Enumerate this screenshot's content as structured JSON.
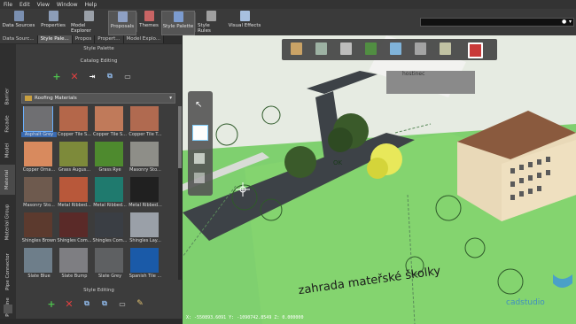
{
  "menu": [
    "File",
    "Edit",
    "View",
    "Window",
    "Help"
  ],
  "ribbon": {
    "buttons": [
      {
        "label": "Data Sources",
        "icon": "database-icon",
        "color": "#7a8fb0"
      },
      {
        "label": "Properties",
        "icon": "properties-icon",
        "color": "#8c9db8"
      },
      {
        "label": "Model Explorer",
        "icon": "model-explorer-icon",
        "color": "#9aa0a8"
      },
      {
        "label": "Proposals",
        "icon": "proposals-icon",
        "color": "#8ea0c4"
      },
      {
        "label": "Themes",
        "icon": "themes-icon",
        "color": "#c86464"
      },
      {
        "label": "Style Palette",
        "icon": "style-palette-icon",
        "color": "#7c9cd0"
      },
      {
        "label": "Style Rules",
        "icon": "style-rules-icon",
        "color": "#a0a0a0"
      },
      {
        "label": "Visual Effects",
        "icon": "visual-effects-icon",
        "color": "#a8c0e0"
      }
    ]
  },
  "panel_tabs": [
    "Data Sourc...",
    "Style Pale...",
    "Propos",
    "Propert...",
    "Model Explo..."
  ],
  "panel_title": "Style Palette",
  "catalog_title": "Catalog Editing",
  "style_editing_title": "Style Editing",
  "vertical_tabs": [
    "Barrier",
    "Facade",
    "Model",
    "Material",
    "Material Group",
    "Pipe Connector",
    "Pipeline"
  ],
  "dropdown": {
    "value": "Roofing Materials"
  },
  "materials": [
    {
      "name": "Asphalt Grey",
      "color": "#6f6f72",
      "selected": true
    },
    {
      "name": "Copper Tile S...",
      "color": "#b4674a"
    },
    {
      "name": "Copper Tile S...",
      "color": "#c07a5a"
    },
    {
      "name": "Copper Tile T...",
      "color": "#b06a50"
    },
    {
      "name": "Copper Orna...",
      "color": "#d88a5e"
    },
    {
      "name": "Grass Augus...",
      "color": "#7d8a3a"
    },
    {
      "name": "Grass Rye",
      "color": "#4e8a2e"
    },
    {
      "name": "Masonry Sto...",
      "color": "#8e8e88"
    },
    {
      "name": "Masonry Sto...",
      "color": "#6e5a4e"
    },
    {
      "name": "Metal Ribbed...",
      "color": "#b8583a"
    },
    {
      "name": "Metal Ribbed...",
      "color": "#1f7a6e"
    },
    {
      "name": "Metal Ribbed...",
      "color": "#202020"
    },
    {
      "name": "Shingles Brown",
      "color": "#5c3a2e"
    },
    {
      "name": "Shingles Com...",
      "color": "#5a2a28"
    },
    {
      "name": "Shingles Com...",
      "color": "#3a3e44"
    },
    {
      "name": "Shingles Lay...",
      "color": "#9aa0a8"
    },
    {
      "name": "Slate Blue",
      "color": "#6e7e8a"
    },
    {
      "name": "Slate Bump",
      "color": "#7e7e82"
    },
    {
      "name": "Slate Grey",
      "color": "#5e6062"
    },
    {
      "name": "Spanish Tile ...",
      "color": "#1a5aa8"
    },
    {
      "name": "",
      "color": "#b5452e"
    },
    {
      "name": "",
      "color": "#4a4a4a"
    },
    {
      "name": "",
      "color": "#8a6e5a"
    },
    {
      "name": "",
      "color": "#b56a3a"
    }
  ],
  "viewport": {
    "label_hostinec": "hostinec",
    "label_ok": "OK",
    "label_garden": "zahrada mateřské školky",
    "watermark": "cadstudio",
    "status": "X: -550893.6091  Y: -1090742.8549  Z: 0.000000"
  }
}
